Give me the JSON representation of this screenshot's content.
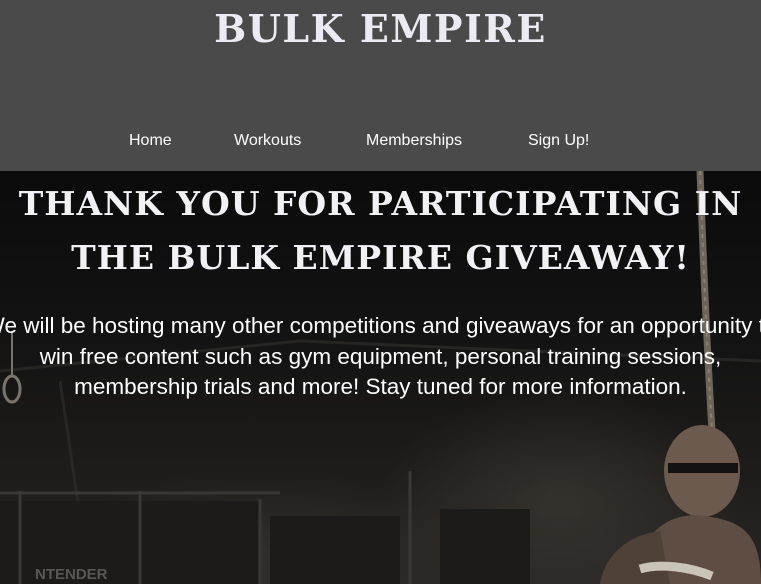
{
  "header": {
    "site_title": "BULK EMPIRE",
    "nav": [
      {
        "label": "Home"
      },
      {
        "label": "Workouts"
      },
      {
        "label": "Memberships"
      },
      {
        "label": "Sign Up!"
      }
    ]
  },
  "hero": {
    "heading": "THANK YOU FOR PARTICIPATING IN THE BULK EMPIRE GIVEAWAY!",
    "body": "We will be hosting many other competitions and giveaways for an opportunity to win free content such as gym equipment, personal training sessions, membership trials and more! Stay tuned for more information.",
    "background_sign_text": "NTENDER"
  },
  "colors": {
    "header_bg": "#4a4a4a",
    "title_text": "#ecebf3",
    "nav_text": "#ffffff",
    "hero_bg": "#0b0b0b",
    "hero_text": "#ffffff"
  }
}
